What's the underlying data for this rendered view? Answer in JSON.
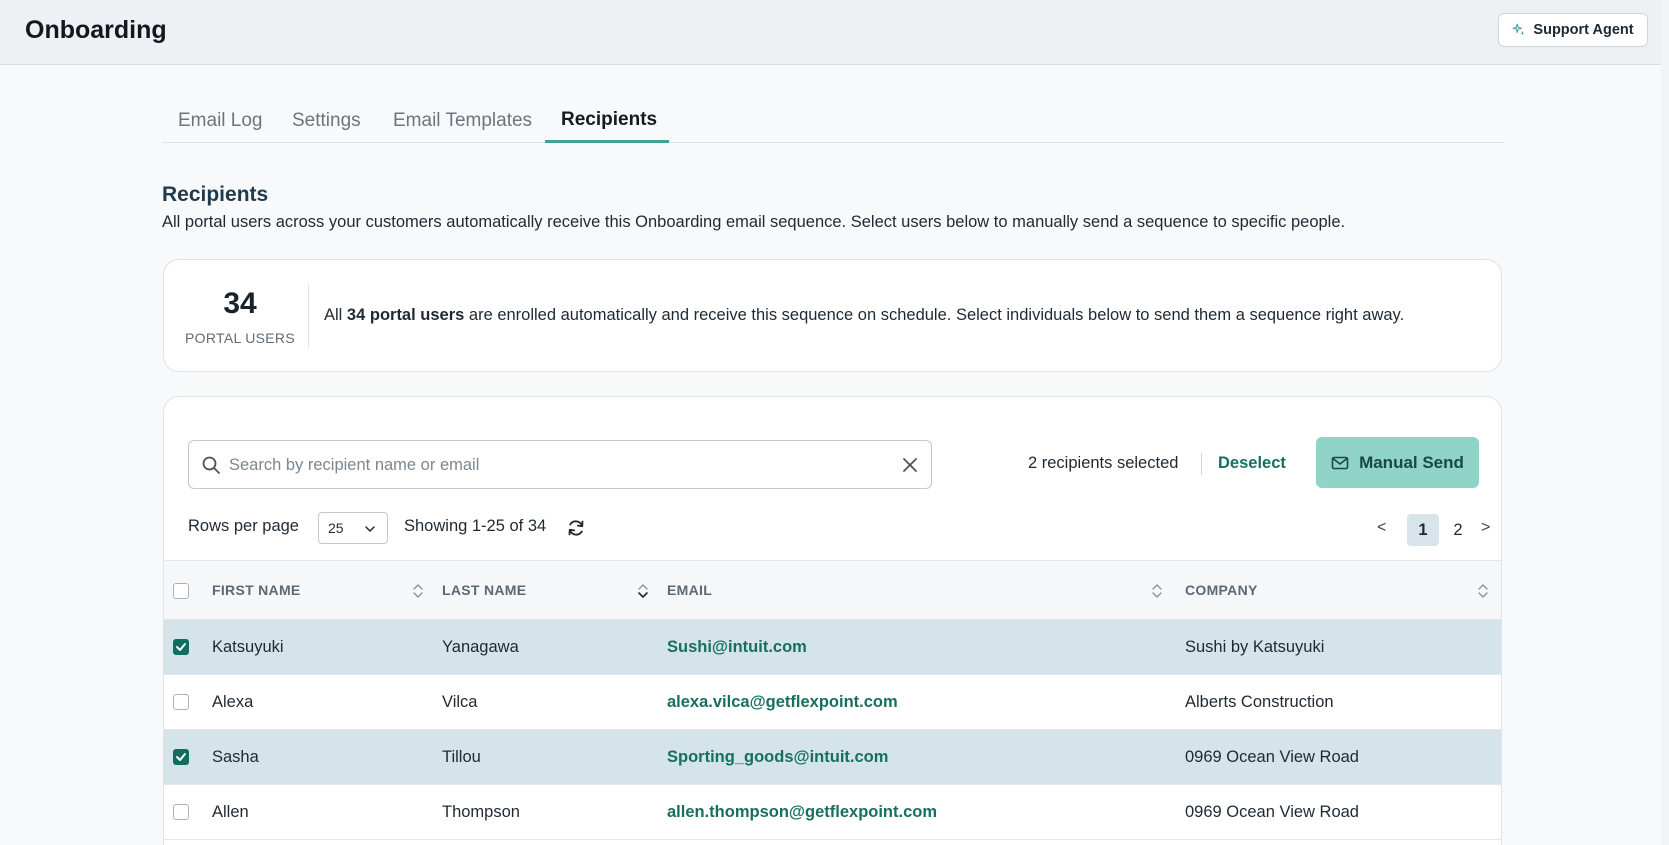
{
  "header": {
    "title": "Onboarding",
    "support_label": "Support Agent"
  },
  "tabs": [
    {
      "label": "Email Log"
    },
    {
      "label": "Settings"
    },
    {
      "label": "Email Templates"
    },
    {
      "label": "Recipients",
      "active": true
    }
  ],
  "section": {
    "title": "Recipients",
    "description": "All portal users across your customers automatically receive this Onboarding email sequence. Select users below to manually send a sequence to specific people."
  },
  "summary": {
    "count": "34",
    "count_label": "PORTAL USERS",
    "text_prefix": "All ",
    "text_bold": "34 portal users",
    "text_suffix": " are enrolled automatically and receive this sequence on schedule. Select individuals below to send them a sequence right away."
  },
  "toolbar": {
    "search_placeholder": "Search by recipient name or email",
    "selected_text": "2 recipients selected",
    "deselect_label": "Deselect",
    "manual_send_label": "Manual Send",
    "rows_per_page_label": "Rows per page",
    "rows_per_page_value": "25",
    "showing_text": "Showing 1-25 of 34"
  },
  "pagination": {
    "prev": "<",
    "next": ">",
    "pages": [
      "1",
      "2"
    ],
    "current": "1"
  },
  "table": {
    "columns": [
      "FIRST NAME",
      "LAST NAME",
      "EMAIL",
      "COMPANY"
    ],
    "rows": [
      {
        "checked": true,
        "first": "Katsuyuki",
        "last": "Yanagawa",
        "email": "Sushi@intuit.com",
        "company": "Sushi by Katsuyuki"
      },
      {
        "checked": false,
        "first": "Alexa",
        "last": "Vilca",
        "email": "alexa.vilca@getflexpoint.com",
        "company": "Alberts Construction"
      },
      {
        "checked": true,
        "first": "Sasha",
        "last": "Tillou",
        "email": "Sporting_goods@intuit.com",
        "company": "0969 Ocean View Road"
      },
      {
        "checked": false,
        "first": "Allen",
        "last": "Thompson",
        "email": "allen.thompson@getflexpoint.com",
        "company": "0969 Ocean View Road"
      }
    ]
  },
  "colors": {
    "accent": "#3ba496",
    "primary_dark": "#17705f",
    "selected_row": "#d5e3ea",
    "send_button": "#90d3c7"
  },
  "icons": [
    "sparkle-icon",
    "search-icon",
    "close-icon",
    "mail-icon",
    "chevron-down-icon",
    "refresh-icon",
    "sort-icon",
    "checkmark-icon"
  ]
}
